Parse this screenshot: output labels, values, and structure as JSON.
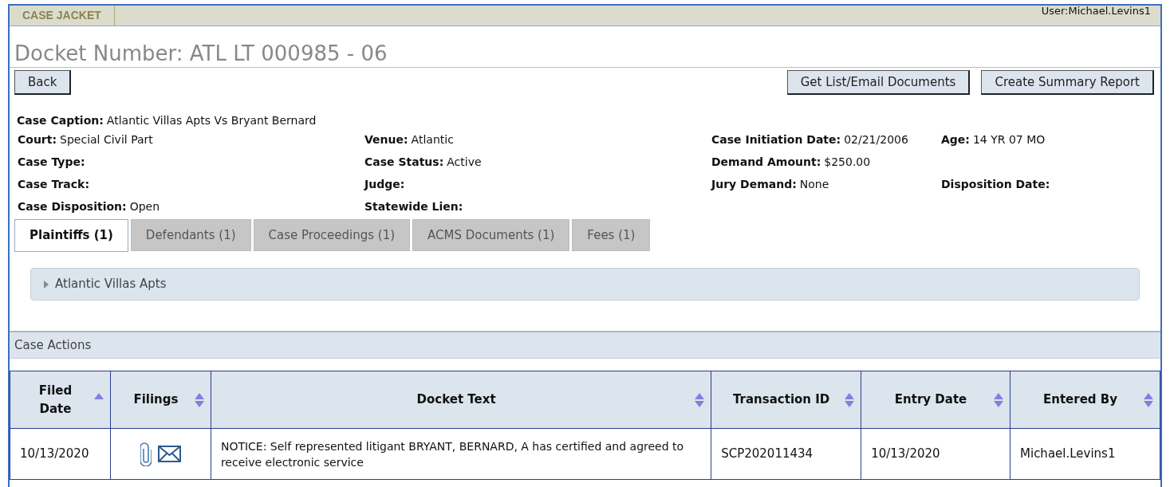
{
  "header": {
    "tab": "CASE JACKET",
    "user": "User:Michael.Levins1"
  },
  "docket_title": "Docket Number:  ATL LT 000985 - 06",
  "buttons_left": [
    "Back"
  ],
  "buttons_right": [
    "Get List/Email Documents",
    "Create Summary Report"
  ],
  "caption": {
    "label": "Case Caption:",
    "value": "Atlantic Villas Apts Vs Bryant Bernard"
  },
  "field_rows": [
    {
      "left": {
        "label": "Court:",
        "value": "Special Civil Part"
      },
      "middle": {
        "label": "Venue:",
        "value": "Atlantic"
      },
      "right": {
        "label": "Case Initiation Date:",
        "value": "02/21/2006"
      },
      "far_right": {
        "label": "Age:",
        "value": "14 YR 07 MO"
      }
    },
    {
      "left": {
        "label": "Case Type:"
      },
      "middle": {
        "label": "Case Status:",
        "value": "Active"
      },
      "right": {
        "label": "Demand Amount:",
        "value": "$250.00"
      }
    },
    {
      "left": {
        "label": "Case Track:"
      },
      "middle": {
        "label": "Judge:"
      },
      "right": {
        "label": "Jury Demand:",
        "value": "None"
      },
      "far_right": {
        "label": "Disposition Date:"
      }
    },
    {
      "left": {
        "label": "Case Disposition:",
        "value": "Open"
      },
      "middle": {
        "label": "Statewide Lien:"
      }
    }
  ],
  "tabs": [
    {
      "label": "Plaintiffs (1)",
      "selected": true
    },
    {
      "label": "Defendants (1)",
      "selected": false
    },
    {
      "label": "Case Proceedings (1)",
      "selected": false
    },
    {
      "label": "ACMS Documents (1)",
      "selected": false
    },
    {
      "label": "Fees (1)",
      "selected": false
    }
  ],
  "panel_items": [
    {
      "label": "Atlantic Villas Apts",
      "expanded": false
    }
  ],
  "case_actions": {
    "title": "Case Actions",
    "columns": [
      {
        "label": "Filed Date",
        "sorted": true
      },
      {
        "label": "Filings",
        "sorted": false
      },
      {
        "label": "Docket Text",
        "sorted": false
      },
      {
        "label": "Transaction ID",
        "sorted": false
      },
      {
        "label": "Entry Date",
        "sorted": false
      },
      {
        "label": "Entered By",
        "sorted": false
      }
    ],
    "rows": [
      {
        "filed_date": "10/13/2020",
        "attachment": true,
        "email": true,
        "docket_text": "NOTICE: Self represented litigant BRYANT, BERNARD, A has certified and agreed to receive electronic service",
        "transaction_id": "SCP202011434",
        "entry_date": "10/13/2020",
        "entered_by": "Michael.Levins1"
      }
    ]
  }
}
